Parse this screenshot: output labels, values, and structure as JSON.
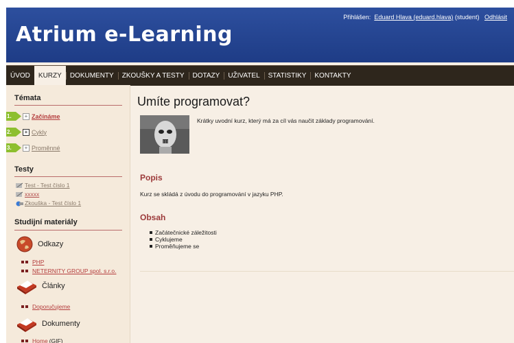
{
  "header": {
    "site_title": "Atrium e-Learning",
    "logged_in_label": "Přihlášen:",
    "user_name": "Eduard Hlava (eduard.hlava)",
    "user_role": "(student)",
    "logout_label": "Odhlásit"
  },
  "nav": {
    "items": [
      {
        "label": "ÚVOD"
      },
      {
        "label": "KURZY",
        "active": true
      },
      {
        "label": "DOKUMENTY"
      },
      {
        "label": "ZKOUŠKY A TESTY"
      },
      {
        "label": "DOTAZY"
      },
      {
        "label": "UŽIVATEL"
      },
      {
        "label": "STATISTIKY"
      },
      {
        "label": "KONTAKTY"
      }
    ]
  },
  "sidebar": {
    "topics_heading": "Témata",
    "topics": [
      {
        "num": "1.",
        "label": "Začínáme",
        "box": "⊞"
      },
      {
        "num": "2.",
        "label": "Cykly",
        "box": "+"
      },
      {
        "num": "3.",
        "label": "Proměnné",
        "box": "⊞"
      }
    ],
    "tests_heading": "Testy",
    "tests": [
      {
        "label": "Test - Test číslo 1"
      },
      {
        "label": "xxxxx"
      },
      {
        "label": "Zkouška - Test číslo 1"
      }
    ],
    "materials_heading": "Studijní materiály",
    "groups": {
      "odkazy": {
        "label": "Odkazy",
        "links": [
          {
            "label": "PHP"
          },
          {
            "label": "NETERNITY GROUP spol. s.r.o."
          }
        ]
      },
      "clanky": {
        "label": "Články",
        "links": [
          {
            "label": "Doporučujeme"
          }
        ]
      },
      "dokumenty": {
        "label": "Dokumenty",
        "links": [
          {
            "label": "Home",
            "suffix": "(GIF)"
          }
        ]
      }
    }
  },
  "main": {
    "title": "Umíte programovat?",
    "description": "Krátky uvodní kurz, který má za cíl vás naučit základy programování.",
    "popis_heading": "Popis",
    "popis_text": "Kurz se skládá z úvodu do programování v jazyku PHP.",
    "obsah_heading": "Obsah",
    "obsah_items": [
      "Začátečnické záležitosti",
      "Cyklujeme",
      "Proměňujeme se"
    ]
  }
}
